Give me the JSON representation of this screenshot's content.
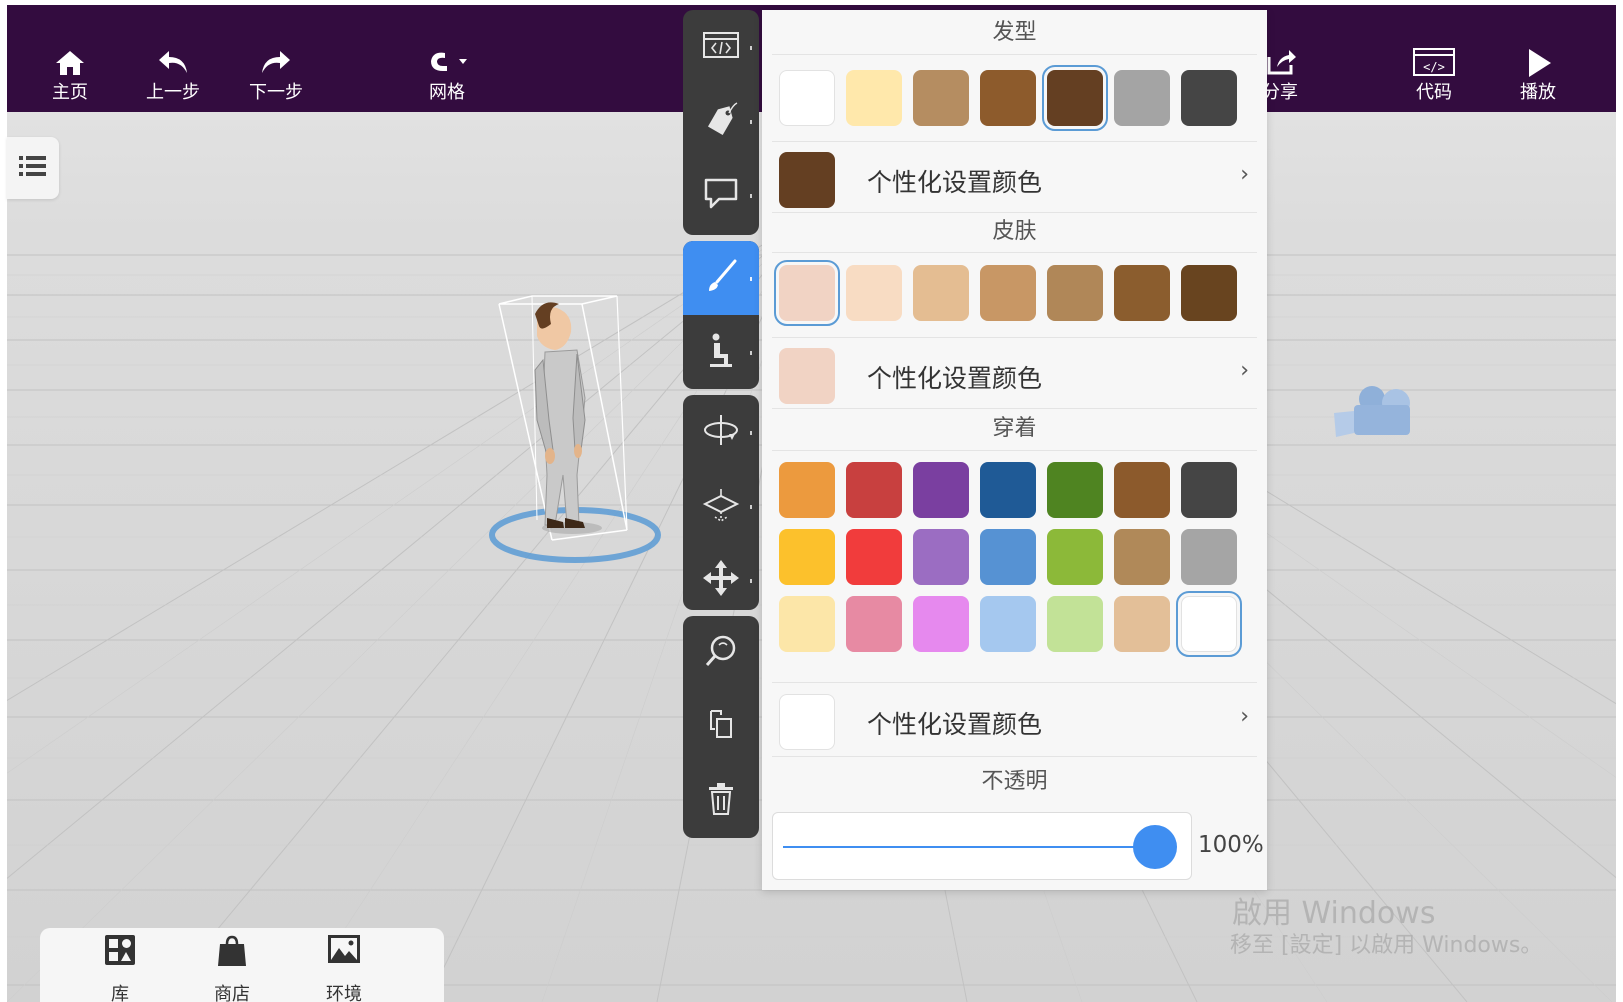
{
  "toolbar": {
    "home_label": "主页",
    "undo_label": "上一步",
    "redo_label": "下一步",
    "grid_label": "网格",
    "share_label": "分享",
    "code_label": "代码",
    "play_label": "播放",
    "code_icon_text": "</>"
  },
  "properties": {
    "hair": {
      "title": "发型",
      "swatches": [
        "#ffffff",
        "#ffe8ab",
        "#b58d61",
        "#8d5b2c",
        "#643f22",
        "#a4a4a4",
        "#454545"
      ],
      "selected_index": 4,
      "custom_label": "个性化设置颜色",
      "custom_color": "#643f22"
    },
    "skin": {
      "title": "皮肤",
      "swatches": [
        "#f1d3c4",
        "#f8dcc3",
        "#e4bd92",
        "#c89765",
        "#b08758",
        "#8b5d2e",
        "#68441f"
      ],
      "selected_index": 0,
      "custom_label": "个性化设置颜色",
      "custom_color": "#f1d3c4"
    },
    "clothing": {
      "title": "穿着",
      "swatches": [
        "#ec9a3e",
        "#c8403f",
        "#7a3fa0",
        "#1f5a96",
        "#4f8421",
        "#8c5a2c",
        "#454545",
        "#fcc12c",
        "#f13c3c",
        "#9b6dc2",
        "#5692d3",
        "#8cb939",
        "#b08959",
        "#a5a5a5",
        "#fce6a8",
        "#e78aa3",
        "#e689ee",
        "#a5c8ef",
        "#c2e297",
        "#e3bf98",
        "#ffffff"
      ],
      "selected_index": 20,
      "custom_label": "个性化设置颜色",
      "custom_color": "#ffffff"
    },
    "opacity": {
      "title": "不透明",
      "value_label": "100%",
      "value": 100
    }
  },
  "dock": {
    "library_label": "库",
    "shop_label": "商店",
    "environment_label": "环境"
  },
  "watermark": {
    "line1": "啟用 Windows",
    "line2": "移至 [設定] 以啟用 Windows。"
  },
  "colors": {
    "topbar": "#330c3f",
    "accent": "#3f8ef1",
    "toolbar_dark": "#3c3c3c"
  }
}
